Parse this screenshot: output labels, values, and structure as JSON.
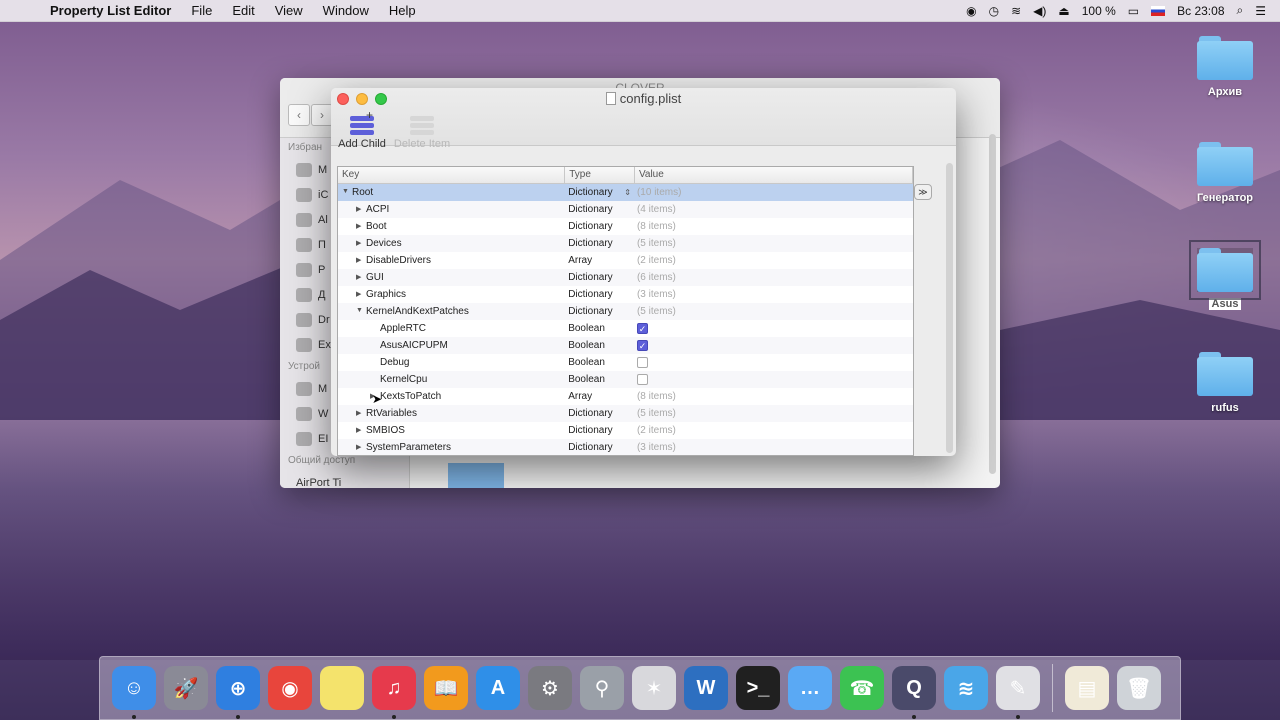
{
  "menubar": {
    "app_name": "Property List Editor",
    "menus": [
      "File",
      "Edit",
      "View",
      "Window",
      "Help"
    ],
    "battery": "100 %",
    "clock": "Вс 23:08"
  },
  "finder": {
    "title": "CLOVER",
    "sidebar_favorites_label": "Избран",
    "sidebar_items": [
      "M",
      "iC",
      "Al",
      "П",
      "Р",
      "Д",
      "Dr",
      "Ex"
    ],
    "sidebar_devices_label": "Устрой",
    "device_items": [
      "M",
      "W",
      "EI"
    ],
    "sidebar_shared_label": "Общий доступ",
    "shared_items": [
      "AirPort Ti"
    ]
  },
  "plist": {
    "title": "config.plist",
    "toolbar": {
      "add_child": "Add Child",
      "delete_item": "Delete Item"
    },
    "columns": {
      "key": "Key",
      "type": "Type",
      "value": "Value"
    },
    "rows": [
      {
        "key": "Root",
        "type": "Dictionary",
        "value": "(10 items)",
        "indent": 0,
        "expanded": true,
        "selected": true
      },
      {
        "key": "ACPI",
        "type": "Dictionary",
        "value": "(4 items)",
        "indent": 1,
        "expanded": false
      },
      {
        "key": "Boot",
        "type": "Dictionary",
        "value": "(8 items)",
        "indent": 1,
        "expanded": false
      },
      {
        "key": "Devices",
        "type": "Dictionary",
        "value": "(5 items)",
        "indent": 1,
        "expanded": false
      },
      {
        "key": "DisableDrivers",
        "type": "Array",
        "value": "(2 items)",
        "indent": 1,
        "expanded": false
      },
      {
        "key": "GUI",
        "type": "Dictionary",
        "value": "(6 items)",
        "indent": 1,
        "expanded": false
      },
      {
        "key": "Graphics",
        "type": "Dictionary",
        "value": "(3 items)",
        "indent": 1,
        "expanded": false
      },
      {
        "key": "KernelAndKextPatches",
        "type": "Dictionary",
        "value": "(5 items)",
        "indent": 1,
        "expanded": true
      },
      {
        "key": "AppleRTC",
        "type": "Boolean",
        "checked": true,
        "indent": 2
      },
      {
        "key": "AsusAICPUPM",
        "type": "Boolean",
        "checked": true,
        "indent": 2
      },
      {
        "key": "Debug",
        "type": "Boolean",
        "checked": false,
        "indent": 2
      },
      {
        "key": "KernelCpu",
        "type": "Boolean",
        "checked": false,
        "indent": 2
      },
      {
        "key": "KextsToPatch",
        "type": "Array",
        "value": "(8 items)",
        "indent": 2,
        "expanded": false
      },
      {
        "key": "RtVariables",
        "type": "Dictionary",
        "value": "(5 items)",
        "indent": 1,
        "expanded": false
      },
      {
        "key": "SMBIOS",
        "type": "Dictionary",
        "value": "(2 items)",
        "indent": 1,
        "expanded": false
      },
      {
        "key": "SystemParameters",
        "type": "Dictionary",
        "value": "(3 items)",
        "indent": 1,
        "expanded": false
      }
    ]
  },
  "desktop_icons": [
    {
      "label": "Архив",
      "selected": false
    },
    {
      "label": "Генератор",
      "selected": false
    },
    {
      "label": "Asus",
      "selected": true
    },
    {
      "label": "rufus",
      "selected": false
    }
  ],
  "dock": [
    {
      "name": "finder",
      "color": "#3f8ee8",
      "glyph": "☺",
      "running": true
    },
    {
      "name": "launchpad",
      "color": "#8a8a96",
      "glyph": "🚀",
      "running": false
    },
    {
      "name": "safari",
      "color": "#2f7fe0",
      "glyph": "⊕",
      "running": true
    },
    {
      "name": "chrome",
      "color": "#e8453c",
      "glyph": "◉",
      "running": false
    },
    {
      "name": "notes",
      "color": "#f4e36c",
      "glyph": "",
      "running": false
    },
    {
      "name": "itunes",
      "color": "#e63a4c",
      "glyph": "♫",
      "running": true
    },
    {
      "name": "ibooks",
      "color": "#f29a1d",
      "glyph": "📖",
      "running": false
    },
    {
      "name": "app-store",
      "color": "#2f8fe8",
      "glyph": "A",
      "running": false
    },
    {
      "name": "system-preferences",
      "color": "#7a7a80",
      "glyph": "⚙",
      "running": false
    },
    {
      "name": "plist-editor",
      "color": "#9aa0a8",
      "glyph": "⚲",
      "running": false
    },
    {
      "name": "kext-utility",
      "color": "#d8d8dc",
      "glyph": "✶",
      "running": false
    },
    {
      "name": "word",
      "color": "#2d6fc0",
      "glyph": "W",
      "running": false
    },
    {
      "name": "terminal",
      "color": "#202020",
      "glyph": ">_",
      "running": false
    },
    {
      "name": "messages",
      "color": "#5aa9f4",
      "glyph": "…",
      "running": false
    },
    {
      "name": "facetime",
      "color": "#3cc252",
      "glyph": "☎",
      "running": false
    },
    {
      "name": "quicktime",
      "color": "#4a4a6a",
      "glyph": "Q",
      "running": true
    },
    {
      "name": "wifi-utility",
      "color": "#4aa6e8",
      "glyph": "≋",
      "running": false
    },
    {
      "name": "preview",
      "color": "#e0e0e4",
      "glyph": "✎",
      "running": true
    },
    {
      "name": "documents",
      "color": "#f0ead8",
      "glyph": "▤",
      "running": false
    },
    {
      "name": "trash",
      "color": "#cfd3d8",
      "glyph": "🗑",
      "running": false
    }
  ]
}
